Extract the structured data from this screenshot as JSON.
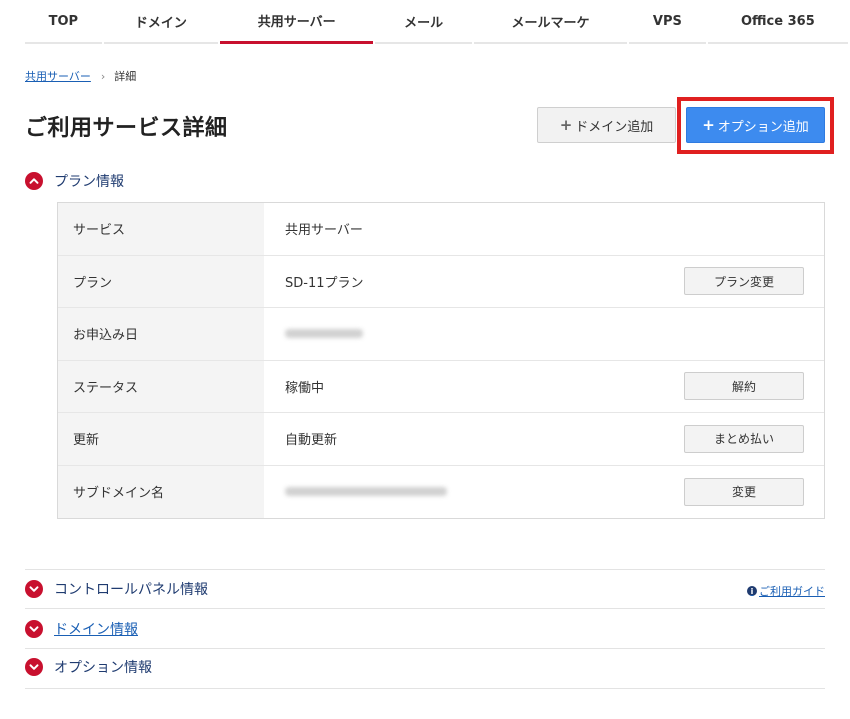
{
  "nav": {
    "tabs": [
      {
        "label": "TOP"
      },
      {
        "label": "ドメイン"
      },
      {
        "label": "共用サーバー"
      },
      {
        "label": "メール"
      },
      {
        "label": "メールマーケ"
      },
      {
        "label": "VPS"
      },
      {
        "label": "Office 365"
      }
    ],
    "active_index": 2
  },
  "breadcrumb": {
    "parent": "共用サーバー",
    "current": "詳細"
  },
  "page_title": "ご利用サービス詳細",
  "header_buttons": {
    "add_domain": "ドメイン追加",
    "add_option": "オプション追加"
  },
  "sections": {
    "plan": "プラン情報",
    "control_panel": "コントロールパネル情報",
    "domain": "ドメイン情報",
    "option": "オプション情報"
  },
  "plan_table": {
    "rows": [
      {
        "label": "サービス",
        "value": "共用サーバー",
        "button": ""
      },
      {
        "label": "プラン",
        "value": "SD-11プラン",
        "button": "プラン変更"
      },
      {
        "label": "お申込み日",
        "value": "",
        "button": ""
      },
      {
        "label": "ステータス",
        "value": "稼働中",
        "button": "解約"
      },
      {
        "label": "更新",
        "value": "自動更新",
        "button": "まとめ払い"
      },
      {
        "label": "サブドメイン名",
        "value": "",
        "button": "変更"
      }
    ]
  },
  "guide_link": "ご利用ガイド",
  "colors": {
    "accent_red": "#c8102e",
    "primary_blue": "#3d8bef",
    "highlight": "#e02020"
  }
}
